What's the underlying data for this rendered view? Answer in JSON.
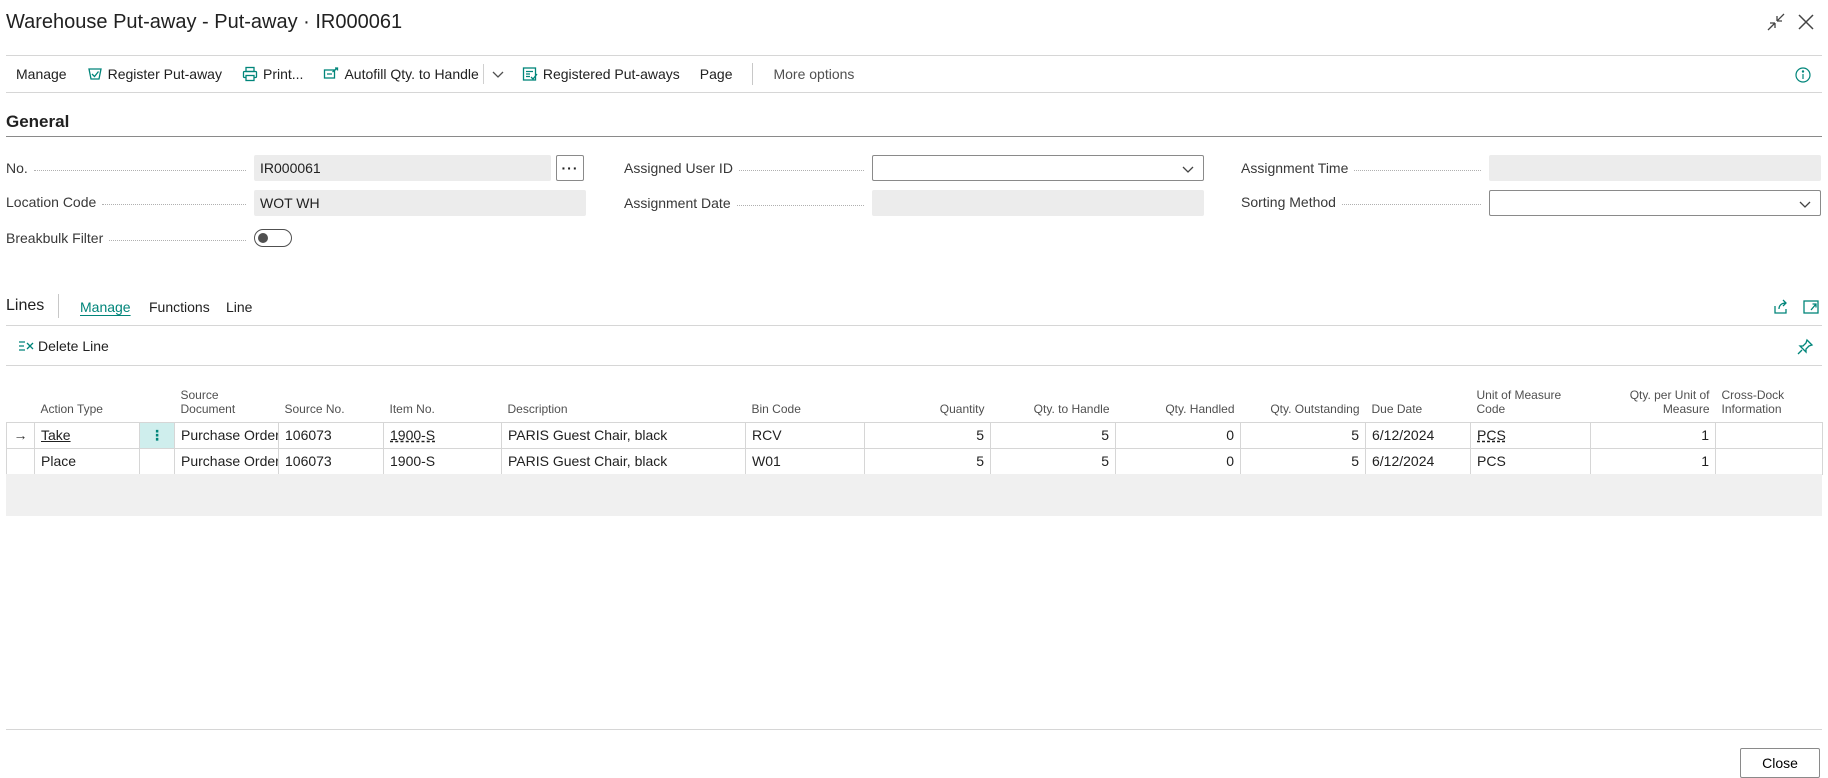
{
  "window": {
    "title": "Warehouse Put-away - Put-away · IR000061"
  },
  "actionbar": {
    "items": [
      {
        "label": "Manage"
      },
      {
        "label": "Register Put-away",
        "icon": "register-icon"
      },
      {
        "label": "Print...",
        "icon": "print-icon"
      },
      {
        "label": "Autofill Qty. to Handle",
        "icon": "autofill-icon"
      },
      {
        "label": "Registered Put-aways",
        "icon": "registered-list-icon"
      },
      {
        "label": "Page"
      },
      {
        "label": "More options"
      }
    ]
  },
  "general": {
    "title": "General",
    "no_label": "No.",
    "no_value": "IR000061",
    "location_label": "Location Code",
    "location_value": "WOT WH",
    "breakbulk_label": "Breakbulk Filter",
    "breakbulk_on": false,
    "assigned_user_label": "Assigned User ID",
    "assigned_user_value": "",
    "assignment_date_label": "Assignment Date",
    "assignment_date_value": "",
    "assignment_time_label": "Assignment Time",
    "assignment_time_value": "",
    "sorting_label": "Sorting Method",
    "sorting_value": ""
  },
  "lines": {
    "title": "Lines",
    "tabs": [
      "Manage",
      "Functions",
      "Line"
    ],
    "delete_label": "Delete Line",
    "columns": {
      "action_type": "Action Type",
      "source_document": "Source Document",
      "source_no": "Source No.",
      "item_no": "Item No.",
      "description": "Description",
      "bin_code": "Bin Code",
      "quantity": "Quantity",
      "qty_to_handle": "Qty. to Handle",
      "qty_handled": "Qty. Handled",
      "qty_outstanding": "Qty. Outstanding",
      "due_date": "Due Date",
      "uom": "Unit of Measure Code",
      "qty_per_uom": "Qty. per Unit of Measure",
      "cross_dock": "Cross-Dock Information"
    },
    "rows": [
      {
        "action_type": "Take",
        "source_document": "Purchase Order",
        "source_no": "106073",
        "item_no": "1900-S",
        "description": "PARIS Guest Chair, black",
        "bin_code": "RCV",
        "quantity": "5",
        "qty_to_handle": "5",
        "qty_handled": "0",
        "qty_outstanding": "5",
        "due_date": "6/12/2024",
        "uom": "PCS",
        "qty_per_uom": "1",
        "cross_dock": ""
      },
      {
        "action_type": "Place",
        "source_document": "Purchase Order",
        "source_no": "106073",
        "item_no": "1900-S",
        "description": "PARIS Guest Chair, black",
        "bin_code": "W01",
        "quantity": "5",
        "qty_to_handle": "5",
        "qty_handled": "0",
        "qty_outstanding": "5",
        "due_date": "6/12/2024",
        "uom": "PCS",
        "qty_per_uom": "1",
        "cross_dock": ""
      }
    ]
  },
  "footer": {
    "close_label": "Close"
  },
  "colors": {
    "accent": "#00857a",
    "selected_cell": "#cfeeed"
  }
}
